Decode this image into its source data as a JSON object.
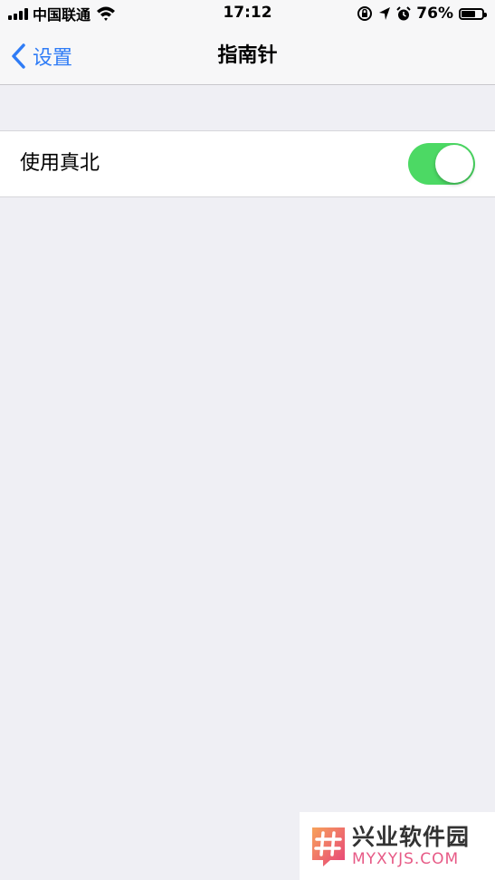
{
  "status_bar": {
    "carrier": "中国联通",
    "time": "17:12",
    "battery_percent": "76%",
    "battery_level": 0.76,
    "icons": [
      "signal-icon",
      "wifi-icon",
      "rotation-lock-icon",
      "location-icon",
      "alarm-icon",
      "battery-icon"
    ]
  },
  "nav": {
    "back_label": "设置",
    "title": "指南针"
  },
  "settings": {
    "true_north": {
      "label": "使用真北",
      "enabled": true
    }
  },
  "colors": {
    "accent": "#2f7cf6",
    "toggle_on": "#4cd964",
    "background": "#efeff4"
  },
  "watermark": {
    "name": "兴业软件园",
    "url": "MYXYJS.COM"
  }
}
